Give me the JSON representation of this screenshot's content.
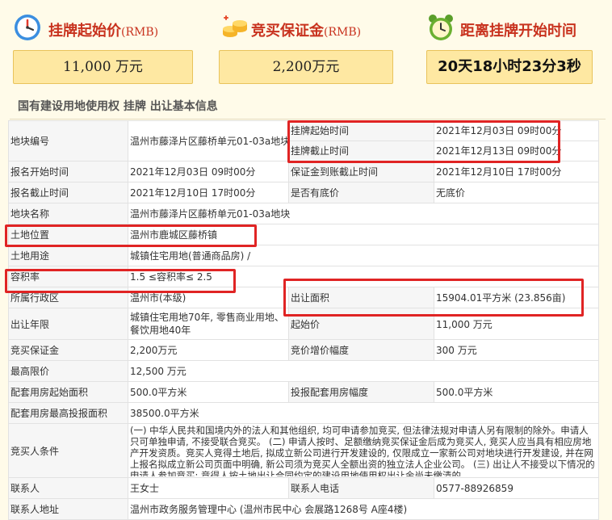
{
  "metrics": {
    "start_price": {
      "label": "挂牌起始价",
      "unit_note": "(RMB)",
      "value": "11,000  万元",
      "icon": "clock-icon"
    },
    "deposit": {
      "label": "竞买保证金",
      "unit_note": "(RMB)",
      "value": "2,200万元",
      "icon": "coins-icon"
    },
    "countdown": {
      "label": "距离挂牌开始时间",
      "value": "20天18小时23分3秒",
      "icon": "alarm-clock-icon"
    }
  },
  "section_title": "国有建设用地使用权 挂牌 出让基本信息",
  "table": {
    "parcel_no": {
      "label": "地块编号",
      "value": "温州市藤泽片区藤桥单元01-03a地块"
    },
    "listing_start": {
      "label": "挂牌起始时间",
      "value": "2021年12月03日 09时00分"
    },
    "listing_end": {
      "label": "挂牌截止时间",
      "value": "2021年12月13日 09时00分"
    },
    "reg_start": {
      "label": "报名开始时间",
      "value": "2021年12月03日 09时00分"
    },
    "deposit_deadline": {
      "label": "保证金到账截止时间",
      "value": "2021年12月10日 17时00分"
    },
    "reg_end": {
      "label": "报名截止时间",
      "value": "2021年12月10日 17时00分"
    },
    "reserve": {
      "label": "是否有底价",
      "value": "无底价"
    },
    "parcel_name": {
      "label": "地块名称",
      "value": "温州市藤泽片区藤桥单元01-03a地块"
    },
    "location": {
      "label": "土地位置",
      "value": "温州市鹿城区藤桥镇"
    },
    "land_use": {
      "label": "土地用途",
      "value": "城镇住宅用地(普通商品房) /"
    },
    "far": {
      "label": "容积率",
      "value": "1.5 ≤容积率≤ 2.5"
    },
    "district": {
      "label": "所属行政区",
      "value": "温州市(本级)"
    },
    "area": {
      "label": "出让面积",
      "value": "15904.01平方米 (23.856亩)"
    },
    "term": {
      "label": "出让年限",
      "value": "城镇住宅用地70年, 零售商业用地、餐饮用地40年"
    },
    "start_price": {
      "label": "起始价",
      "value": "11,000 万元"
    },
    "deposit": {
      "label": "竞买保证金",
      "value": "2,200万元"
    },
    "increment": {
      "label": "竞价增价幅度",
      "value": "300 万元"
    },
    "max_price": {
      "label": "最高限价",
      "value": "12,500 万元"
    },
    "housing_start_area": {
      "label": "配套用房起始面积",
      "value": "500.0平方米"
    },
    "housing_increment": {
      "label": "投报配套用房幅度",
      "value": "500.0平方米"
    },
    "housing_max_area": {
      "label": "配套用房最高投报面积",
      "value": "38500.0平方米"
    },
    "conditions": {
      "label": "竞买人条件",
      "value": "(一) 中华人民共和国境内外的法人和其他组织, 均可申请参加竞买, 但法律法规对申请人另有限制的除外。申请人只可单独申请, 不接受联合竞买。 (二) 申请人按时、足额缴纳竞买保证金后成为竞买人, 竞买人应当具有相应房地产开发资质。竞买人竞得土地后, 拟成立新公司进行开发建设的, 仅限成立一家新公司对地块进行开发建设, 并在网上报名拟成立新公司页面中明确, 新公司须为竞买人全额出资的独立法人企业公司。 (三) 出让人不接受以下情况的申请人参加竞买: 竞得人按土地出让合同约定的建设用地使用权出让金尚未缴清的"
    },
    "contact": {
      "label": "联系人",
      "value": "王女士"
    },
    "phone": {
      "label": "联系人电话",
      "value": "0577-88926859"
    },
    "contact_addr": {
      "label": "联系人地址",
      "value": "温州市政务服务管理中心 (温州市民中心 会展路1268号 A座4楼)"
    }
  },
  "colors": {
    "accent_red": "#c8321e",
    "highlight_red": "#e02424",
    "metric_box": "#fee8a2",
    "page_bg": "#fffbe9"
  }
}
